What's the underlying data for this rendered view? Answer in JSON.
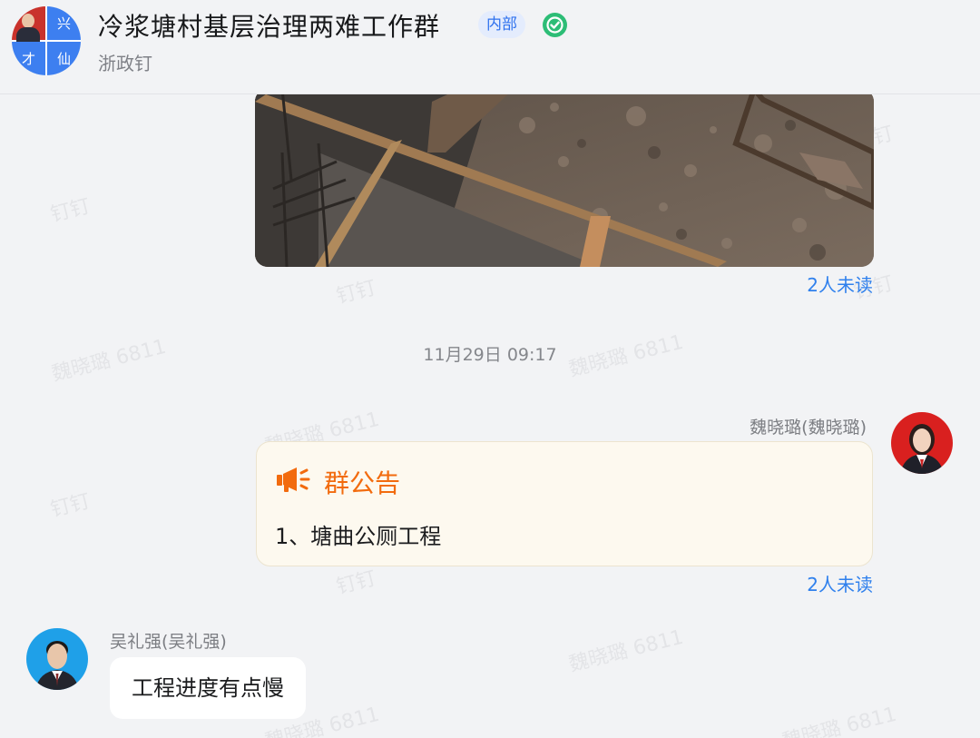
{
  "header": {
    "title": "冷浆塘村基层治理两难工作群",
    "badge": "内部",
    "subtitle": "浙政钉",
    "avatar_chars": [
      "兴",
      "才",
      "仙"
    ]
  },
  "colors": {
    "accent_blue": "#2f80ed",
    "verified_green": "#2dbd76",
    "notice_orange": "#f26b0e",
    "notice_bg": "#fdf9ef",
    "background": "#f2f3f5"
  },
  "messages": {
    "image_read_status": "2人未读",
    "timestamp": "11月29日 09:17",
    "notice": {
      "sender": "魏晓璐(魏晓璐)",
      "title": "群公告",
      "body": "1、塘曲公厕工程",
      "read_status": "2人未读",
      "icon": "megaphone-icon"
    },
    "text_message": {
      "sender": "吴礼强(吴礼强)",
      "text": "工程进度有点慢"
    }
  },
  "watermarks": {
    "name": "魏晓璐 6811",
    "app": "钉钉"
  }
}
